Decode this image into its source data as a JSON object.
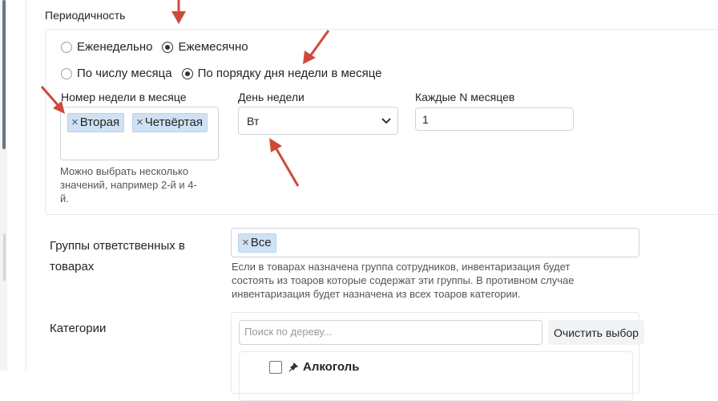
{
  "periodicity": {
    "title": "Периодичность",
    "frequency": {
      "options": [
        {
          "label": "Еженедельно",
          "checked": false
        },
        {
          "label": "Ежемесячно",
          "checked": true
        }
      ]
    },
    "mode": {
      "options": [
        {
          "label": "По числу месяца",
          "checked": false
        },
        {
          "label": "По порядку дня недели в месяце",
          "checked": true
        }
      ]
    },
    "week_number": {
      "label": "Номер недели в месяце",
      "chips": [
        "Вторая",
        "Четвёртая"
      ],
      "chip_remove": "×",
      "help": [
        "Можно выбрать несколько",
        "значений, например 2-й и 4-",
        "й."
      ]
    },
    "weekday": {
      "label": "День недели",
      "selected": "Вт"
    },
    "every_n_months": {
      "label": "Каждые N месяцев",
      "value": "1"
    }
  },
  "groups": {
    "label": [
      "Группы ответственных в",
      "товарах"
    ],
    "chips": [
      "Все"
    ],
    "chip_remove": "×",
    "help": [
      "Если в товарах назначена группа сотрудников, инвентаризация будет",
      "состоять из тоаров которые содержат эти группы. В противном случае",
      "инвентаризация будет назначена из всех тоаров категории."
    ]
  },
  "categories": {
    "label": "Категории",
    "search_placeholder": "Поиск по дереву...",
    "clear_button": "Очистить выбор",
    "tree_items": [
      "Алкоголь"
    ]
  },
  "colors": {
    "chip_bg": "#cfe2f3",
    "annotation_arrow": "#cf4a3a"
  }
}
